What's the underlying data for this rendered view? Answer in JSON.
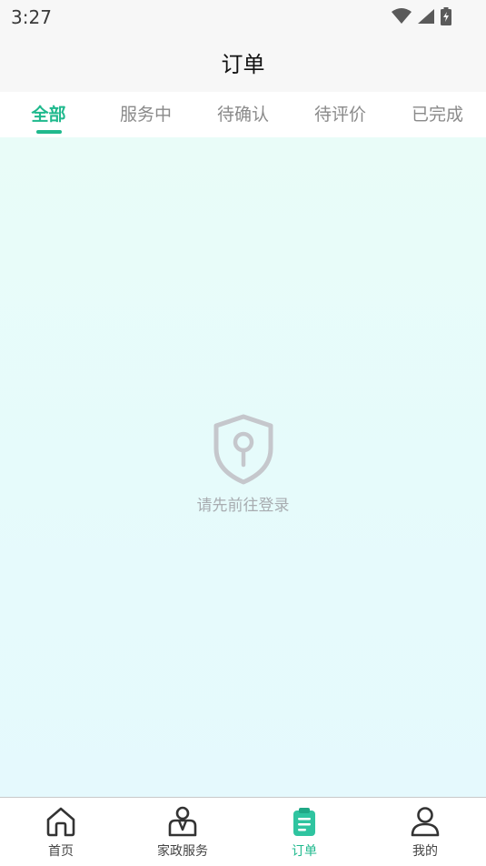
{
  "status": {
    "time": "3:27"
  },
  "header": {
    "title": "订单"
  },
  "tabs": [
    {
      "label": "全部",
      "active": true
    },
    {
      "label": "服务中",
      "active": false
    },
    {
      "label": "待确认",
      "active": false
    },
    {
      "label": "待评价",
      "active": false
    },
    {
      "label": "已完成",
      "active": false
    }
  ],
  "empty": {
    "message": "请先前往登录",
    "icon": "shield-icon"
  },
  "tabbar": [
    {
      "label": "首页",
      "icon": "home-icon",
      "active": false
    },
    {
      "label": "家政服务",
      "icon": "service-person-icon",
      "active": false
    },
    {
      "label": "订单",
      "icon": "clipboard-icon",
      "active": true
    },
    {
      "label": "我的",
      "icon": "user-icon",
      "active": false
    }
  ],
  "colors": {
    "accent": "#1fb98d",
    "inactive": "#8a8a8a",
    "icon_gray": "#c5c7cc"
  }
}
